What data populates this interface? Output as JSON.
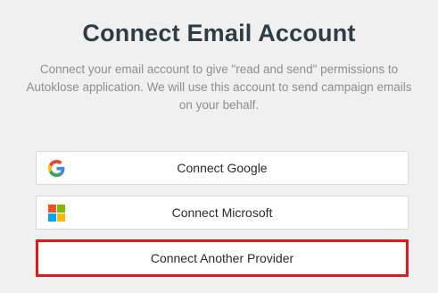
{
  "header": {
    "title": "Connect Email Account",
    "description": "Connect your email account to give \"read and send\" permissions to Autoklose application. We will use this account to send campaign emails on your behalf."
  },
  "providers": [
    {
      "label": "Connect Google",
      "icon": "google-icon"
    },
    {
      "label": "Connect Microsoft",
      "icon": "microsoft-icon"
    },
    {
      "label": "Connect Another Provider",
      "icon": ""
    }
  ],
  "colors": {
    "title": "#2e3d45",
    "highlight_border": "#e0191b",
    "background": "#f0f0f0"
  }
}
